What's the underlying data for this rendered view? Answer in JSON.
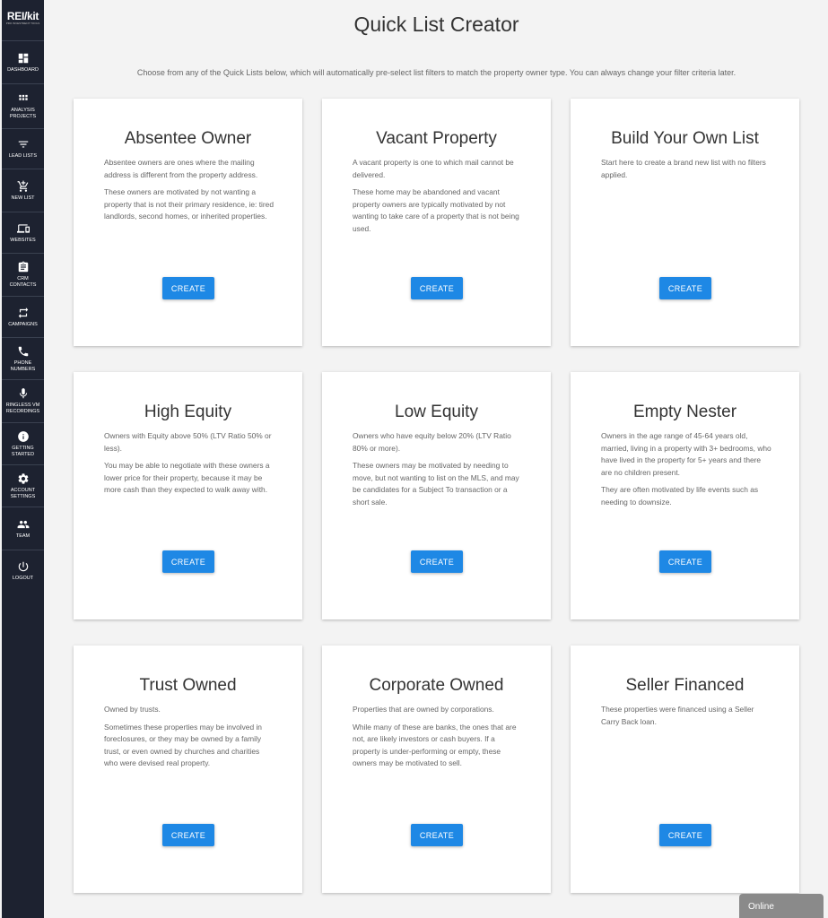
{
  "brand": {
    "logo": "REI/kit",
    "tagline": "PRO INVESTMENT TOOLS"
  },
  "sidebar": {
    "items": [
      {
        "label": "DASHBOARD",
        "icon": "dashboard-icon"
      },
      {
        "label": "ANALYSIS\nPROJECTS",
        "icon": "grid-icon"
      },
      {
        "label": "LEAD LISTS",
        "icon": "filter-icon"
      },
      {
        "label": "NEW LIST",
        "icon": "cart-add-icon"
      },
      {
        "label": "WEBSITES",
        "icon": "devices-icon"
      },
      {
        "label": "CRM\nCONTACTS",
        "icon": "clipboard-icon"
      },
      {
        "label": "CAMPAIGNS",
        "icon": "repeat-icon"
      },
      {
        "label": "PHONE\nNUMBERS",
        "icon": "phone-icon"
      },
      {
        "label": "RINGLESS VM\nRECORDINGS",
        "icon": "mic-icon"
      },
      {
        "label": "GETTING\nSTARTED",
        "icon": "info-icon"
      },
      {
        "label": "ACCOUNT\nSETTINGS",
        "icon": "gear-icon"
      },
      {
        "label": "TEAM",
        "icon": "people-icon"
      },
      {
        "label": "LOGOUT",
        "icon": "power-icon"
      }
    ]
  },
  "page": {
    "title": "Quick List Creator",
    "subtitle": "Choose from any of the Quick Lists below, which will automatically pre-select list filters to match the property owner type. You can always change your filter criteria later."
  },
  "cards": [
    {
      "title": "Absentee Owner",
      "paragraphs": [
        "Absentee owners are ones where the mailing address is different from the property address.",
        "These owners are motivated by not wanting a property that is not their primary residence, ie: tired landlords, second homes, or inherited properties."
      ],
      "button": "CREATE"
    },
    {
      "title": "Vacant Property",
      "paragraphs": [
        "A vacant property is one to which mail cannot be delivered.",
        "These home may be abandoned and vacant property owners are typically motivated by not wanting to take care of a property that is not being used."
      ],
      "button": "CREATE"
    },
    {
      "title": "Build Your Own List",
      "paragraphs": [
        "Start here to create a brand new list with no filters applied.",
        ""
      ],
      "button": "CREATE"
    },
    {
      "title": "High Equity",
      "paragraphs": [
        "Owners with Equity above 50% (LTV Ratio 50% or less).",
        "You may be able to negotiate with these owners a lower price for their property, because it may be more cash than they expected to walk away with."
      ],
      "button": "CREATE"
    },
    {
      "title": "Low Equity",
      "paragraphs": [
        "Owners who have equity below 20% (LTV Ratio 80% or more).",
        "These owners may be motivated by needing to move, but not wanting to list on the MLS, and may be candidates for a Subject To transaction or a short sale."
      ],
      "button": "CREATE"
    },
    {
      "title": "Empty Nester",
      "paragraphs": [
        "Owners in the age range of 45-64 years old, married, living in a property with 3+ bedrooms, who have lived in the property for 5+ years and there are no children present.",
        "They are often motivated by life events such as needing to downsize."
      ],
      "button": "CREATE"
    },
    {
      "title": "Trust Owned",
      "paragraphs": [
        "Owned by trusts.",
        "Sometimes these properties may be involved in foreclosures, or they may be owned by a family trust, or even owned by churches and charities who were devised real property."
      ],
      "button": "CREATE"
    },
    {
      "title": "Corporate Owned",
      "paragraphs": [
        "Properties that are owned by corporations.",
        "While many of these are banks, the ones that are not, are likely investors or cash buyers. If a property is under-performing or empty, these owners may be motivated to sell."
      ],
      "button": "CREATE"
    },
    {
      "title": "Seller Financed",
      "paragraphs": [
        "These properties were financed using a Seller Carry Back loan.",
        ""
      ],
      "button": "CREATE"
    }
  ],
  "chat": {
    "status": "Online"
  },
  "colors": {
    "sidebar": "#1d2230",
    "accent": "#1e88e5",
    "background": "#f3f3f3"
  }
}
